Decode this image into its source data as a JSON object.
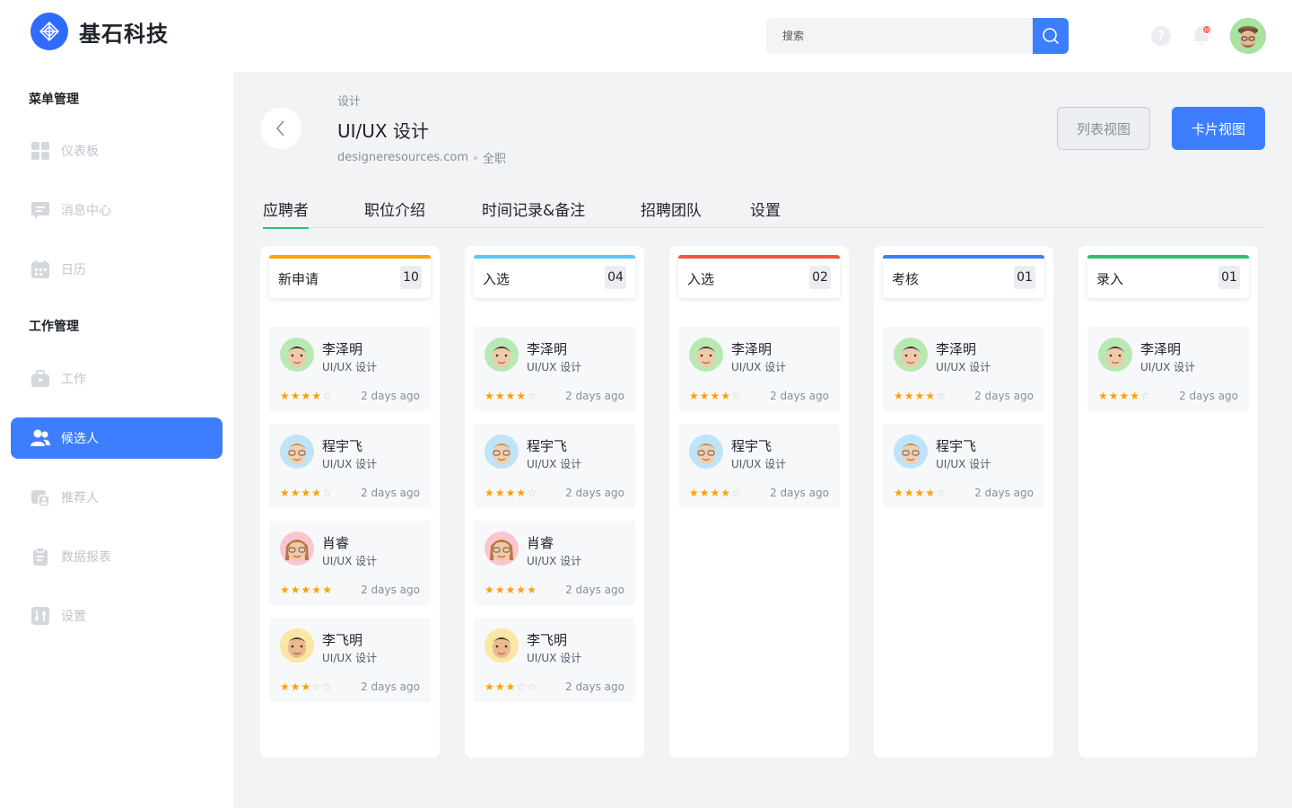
{
  "brand": {
    "name": "基石科技"
  },
  "search": {
    "placeholder": "搜索"
  },
  "header": {
    "notification_badge": "10"
  },
  "sidebar": {
    "sections": [
      {
        "title": "菜单管理",
        "items": [
          {
            "label": "仪表板",
            "icon": "dashboard-icon"
          },
          {
            "label": "消息中心",
            "icon": "message-icon"
          },
          {
            "label": "日历",
            "icon": "calendar-icon"
          }
        ]
      },
      {
        "title": "工作管理",
        "items": [
          {
            "label": "工作",
            "icon": "briefcase-icon"
          },
          {
            "label": "候选人",
            "icon": "users-icon",
            "active": true
          },
          {
            "label": "推荐人",
            "icon": "referrer-icon"
          },
          {
            "label": "数据报表",
            "icon": "clipboard-icon"
          },
          {
            "label": "设置",
            "icon": "settings-sliders-icon"
          }
        ]
      }
    ]
  },
  "job": {
    "crumb": "设计",
    "title": "UI/UX 设计",
    "site": "designeresources.com",
    "type": "全职"
  },
  "views": {
    "list_label": "列表视图",
    "card_label": "卡片视图",
    "active": "card"
  },
  "tabs": [
    {
      "label": "应聘者",
      "active": true
    },
    {
      "label": "职位介绍"
    },
    {
      "label": "时间记录&备注"
    },
    {
      "label": "招聘团队"
    },
    {
      "label": "设置"
    }
  ],
  "colors": {
    "primary": "#3d7eff",
    "star": "#ffa000",
    "new": "#ffa000",
    "shortlist1": "#5ac8f5",
    "shortlist2": "#f5533d",
    "assess": "#3d7eff",
    "hired": "#2fbf71"
  },
  "columns": [
    {
      "name": "新申请",
      "count": "10",
      "color": "#ffa000",
      "cards": [
        {
          "name": "李泽明",
          "role": "UI/UX 设计",
          "rating": 4,
          "time": "2 days ago",
          "avatar": "male-green"
        },
        {
          "name": "程宇飞",
          "role": "UI/UX 设计",
          "rating": 4,
          "time": "2 days ago",
          "avatar": "male-blue"
        },
        {
          "name": "肖睿",
          "role": "UI/UX 设计",
          "rating": 5,
          "time": "2 days ago",
          "avatar": "female-pink"
        },
        {
          "name": "李飞明",
          "role": "UI/UX 设计",
          "rating": 3,
          "time": "2 days ago",
          "avatar": "male-yellow"
        }
      ]
    },
    {
      "name": "入选",
      "count": "04",
      "color": "#5ac8f5",
      "cards": [
        {
          "name": "李泽明",
          "role": "UI/UX 设计",
          "rating": 4,
          "time": "2 days ago",
          "avatar": "male-green"
        },
        {
          "name": "程宇飞",
          "role": "UI/UX 设计",
          "rating": 4,
          "time": "2 days ago",
          "avatar": "male-blue"
        },
        {
          "name": "肖睿",
          "role": "UI/UX 设计",
          "rating": 5,
          "time": "2 days ago",
          "avatar": "female-pink"
        },
        {
          "name": "李飞明",
          "role": "UI/UX 设计",
          "rating": 3,
          "time": "2 days ago",
          "avatar": "male-yellow"
        }
      ]
    },
    {
      "name": "入选",
      "count": "02",
      "color": "#f5533d",
      "cards": [
        {
          "name": "李泽明",
          "role": "UI/UX 设计",
          "rating": 4,
          "time": "2 days ago",
          "avatar": "male-green"
        },
        {
          "name": "程宇飞",
          "role": "UI/UX 设计",
          "rating": 4,
          "time": "2 days ago",
          "avatar": "male-blue"
        }
      ]
    },
    {
      "name": "考核",
      "count": "01",
      "color": "#3d7eff",
      "cards": [
        {
          "name": "李泽明",
          "role": "UI/UX 设计",
          "rating": 4,
          "time": "2 days ago",
          "avatar": "male-green"
        },
        {
          "name": "程宇飞",
          "role": "UI/UX 设计",
          "rating": 4,
          "time": "2 days ago",
          "avatar": "male-blue"
        }
      ]
    },
    {
      "name": "录入",
      "count": "01",
      "color": "#2fbf71",
      "cards": [
        {
          "name": "李泽明",
          "role": "UI/UX 设计",
          "rating": 4,
          "time": "2 days ago",
          "avatar": "male-green"
        }
      ]
    }
  ]
}
